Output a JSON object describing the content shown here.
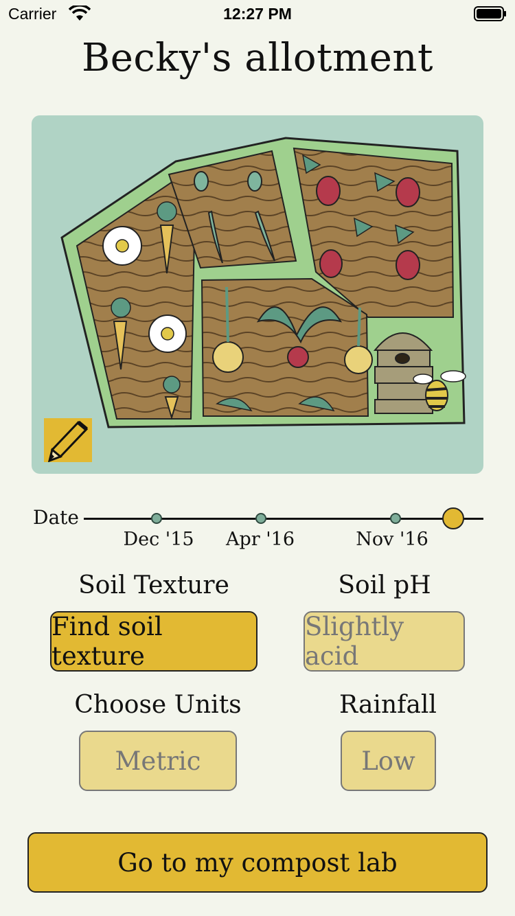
{
  "status_bar": {
    "carrier": "Carrier",
    "time": "12:27 PM"
  },
  "title": "Becky's allotment",
  "timeline": {
    "label": "Date",
    "points": [
      "Dec '15",
      "Apr '16",
      "Nov '16"
    ]
  },
  "soil_texture": {
    "label": "Soil Texture",
    "button": "Find soil texture"
  },
  "soil_ph": {
    "label": "Soil pH",
    "value": "Slightly acid"
  },
  "units": {
    "label": "Choose Units",
    "value": "Metric"
  },
  "rainfall": {
    "label": "Rainfall",
    "value": "Low"
  },
  "compost_button": "Go to my compost lab",
  "colors": {
    "accent": "#e2b933",
    "muted": "#ead98d",
    "map_bg": "#b0d3c5",
    "path": "#9fd08e",
    "soil": "#a17f4c"
  }
}
